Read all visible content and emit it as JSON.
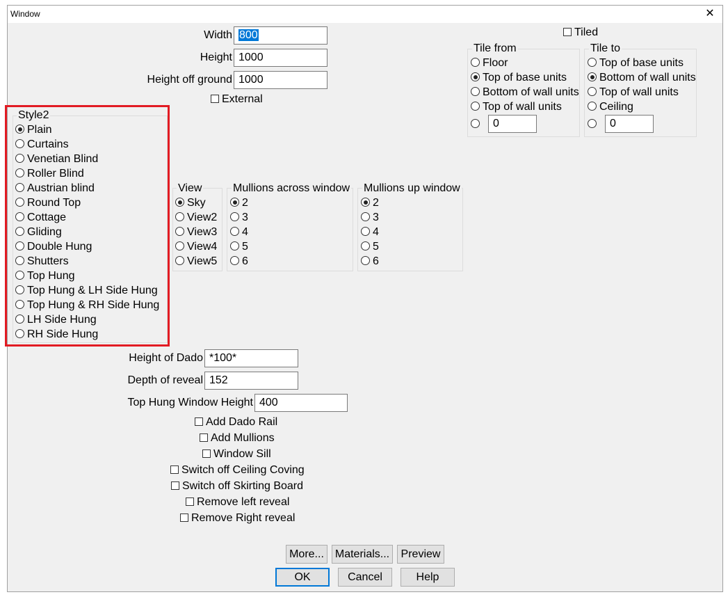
{
  "window": {
    "title": "Window",
    "close_glyph": "✕"
  },
  "dims": {
    "width_label": "Width",
    "width_value": "800",
    "height_label": "Height",
    "height_value": "1000",
    "height_off_ground_label": "Height off ground",
    "height_off_ground_value": "1000",
    "external_label": "External"
  },
  "tiled": {
    "label": "Tiled"
  },
  "tile_from": {
    "title": "Tile from",
    "options": [
      "Floor",
      "Top of base units",
      "Bottom of wall units",
      "Top of wall units"
    ],
    "selected": "Top of base units",
    "custom_value": "0"
  },
  "tile_to": {
    "title": "Tile to",
    "options": [
      "Top of base units",
      "Bottom of wall units",
      "Top of wall units",
      "Ceiling"
    ],
    "selected": "Bottom of wall units",
    "custom_value": "0"
  },
  "style": {
    "title": "Style2",
    "options": [
      "Plain",
      "Curtains",
      "Venetian Blind",
      "Roller Blind",
      "Austrian blind",
      "Round Top",
      "Cottage",
      "Gliding",
      "Double Hung",
      "Shutters",
      "Top Hung",
      "Top Hung & LH Side Hung",
      "Top Hung & RH Side Hung",
      "LH Side Hung",
      "RH Side Hung"
    ],
    "selected": "Plain"
  },
  "view": {
    "title": "View",
    "options": [
      "Sky",
      "View2",
      "View3",
      "View4",
      "View5"
    ],
    "selected": "Sky"
  },
  "mullions_across": {
    "title": "Mullions across window",
    "options": [
      "2",
      "3",
      "4",
      "5",
      "6"
    ],
    "selected": "2"
  },
  "mullions_up": {
    "title": "Mullions up window",
    "options": [
      "2",
      "3",
      "4",
      "5",
      "6"
    ],
    "selected": "2"
  },
  "lower": {
    "height_of_dado_label": "Height of Dado",
    "height_of_dado_value": "*100*",
    "depth_of_reveal_label": "Depth of reveal",
    "depth_of_reveal_value": "152",
    "top_hung_height_label": "Top Hung Window Height",
    "top_hung_height_value": "400"
  },
  "checkboxes": [
    "Add Dado Rail",
    "Add Mullions",
    "Window Sill",
    "Switch off Ceiling Coving",
    "Switch off Skirting Board",
    "Remove left reveal",
    "Remove Right reveal"
  ],
  "buttons": {
    "more": "More...",
    "materials": "Materials...",
    "preview": "Preview",
    "ok": "OK",
    "cancel": "Cancel",
    "help": "Help"
  },
  "colors": {
    "highlight": "#e21b23",
    "accent": "#0078d7",
    "dialog_bg": "#f0f0f0"
  }
}
